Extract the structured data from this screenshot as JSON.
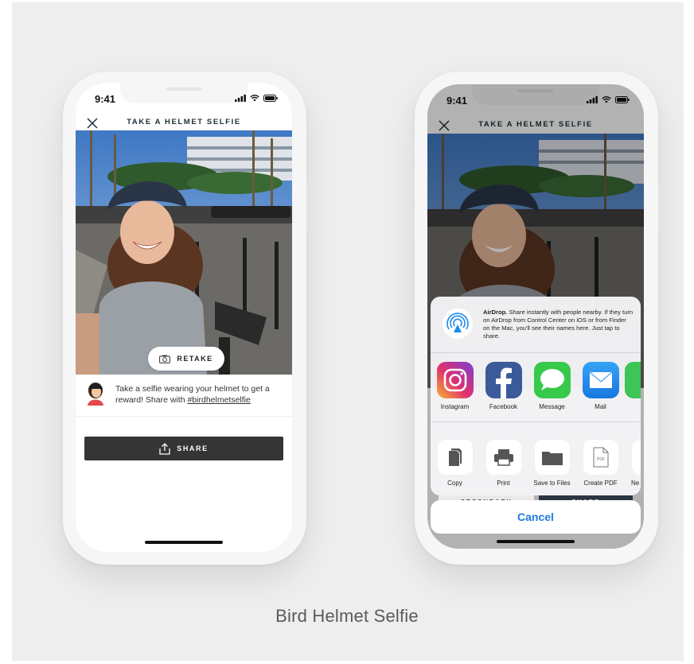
{
  "caption": "Bird Helmet Selfie",
  "phone_left": {
    "status": {
      "time": "9:41"
    },
    "nav": {
      "title": "TAKE A HELMET SELFIE"
    },
    "retake_label": "RETAKE",
    "promo": {
      "text": "Take a selfie wearing your helmet to get a reward! Share with ",
      "hashtag": "#birdhelmetselfie"
    },
    "share_label": "SHARE"
  },
  "phone_right": {
    "status": {
      "time": "9:41"
    },
    "nav": {
      "title": "TAKE A HELMET SELFIE"
    },
    "airdrop": {
      "title": "AirDrop.",
      "text": " Share instantly with people nearby. If they turn on AirDrop from Control Center on iOS or from Finder on the Mac, you'll see their names here. Just tap to share."
    },
    "apps": [
      {
        "label": "Instagram",
        "icon": "instagram-icon"
      },
      {
        "label": "Facebook",
        "icon": "facebook-icon"
      },
      {
        "label": "Message",
        "icon": "message-icon"
      },
      {
        "label": "Mail",
        "icon": "mail-icon"
      }
    ],
    "actions": [
      {
        "label": "Copy",
        "icon": "copy-icon"
      },
      {
        "label": "Print",
        "icon": "print-icon"
      },
      {
        "label": "Save to Files",
        "icon": "folder-icon"
      },
      {
        "label": "Create PDF",
        "icon": "pdf-icon"
      },
      {
        "label": "Ne",
        "icon": "partial-icon"
      }
    ],
    "behind_buttons": {
      "secondary": "SECONDARY",
      "share": "SHARE"
    },
    "cancel_label": "Cancel"
  },
  "colors": {
    "background": "#eeeeef",
    "share_button": "#353535",
    "cancel_blue": "#1f7ae0",
    "title_text": "#1f2f36"
  }
}
